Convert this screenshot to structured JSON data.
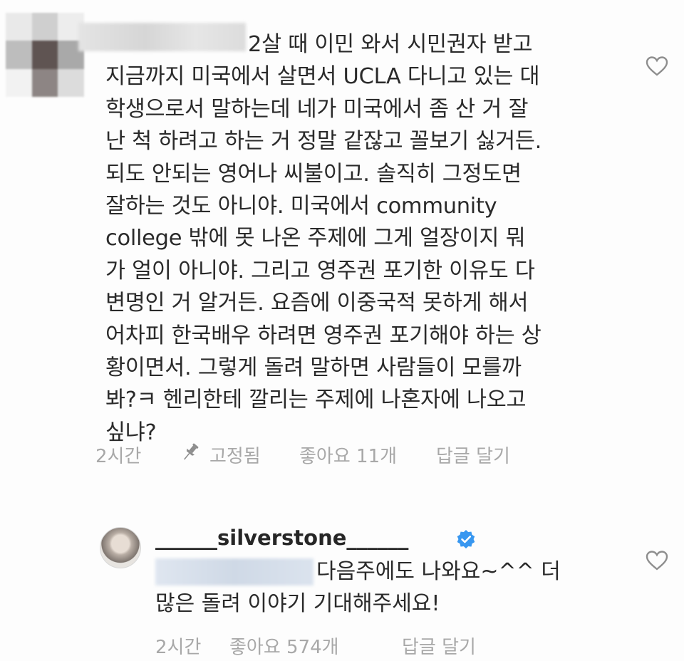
{
  "comment1": {
    "lines": [
      "2살 때 이민 와서 시민권자 받고",
      "지금까지 미국에서 살면서 UCLA 다니고 있는 대",
      "학생으로서 말하는데 네가 미국에서 좀 산 거 잘",
      "난 척 하려고 하는 거 정말 같잖고 꼴보기 싫거든.",
      "되도 안되는 영어나 씨불이고. 솔직히 그정도면",
      "잘하는 것도 아니야. 미국에서 community",
      "college 밖에 못 나온 주제에 그게 얼장이지 뭐",
      "가 얼이 아니야. 그리고 영주권 포기한 이유도 다",
      "변명인 거 알거든. 요즘에 이중국적 못하게 해서",
      "어차피 한국배우 하려면 영주권 포기해야 하는 상",
      "황이면서. 그렇게 돌려 말하면 사람들이 모를까",
      "봐?ㅋ 헨리한테 깔리는 주제에 나혼자에 나오고",
      "싶냐?"
    ],
    "time": "2시간",
    "pinned": "고정됨",
    "likes": "좋아요 11개",
    "reply": "답글 달기"
  },
  "comment2": {
    "username": "______silverstone______",
    "lines": [
      "다음주에도 나와요~^^ 더",
      "많은 돌려 이야기 기대해주세요!"
    ],
    "time": "2시간",
    "likes": "좋아요 574개",
    "reply": "답글 달기"
  },
  "icons": {
    "like": "heart-outline-icon",
    "pin": "pin-icon",
    "verified": "verified-badge-icon"
  },
  "colors": {
    "verified": "#3897f0",
    "meta_text": "#a8a8a8",
    "body_text": "#262626"
  }
}
